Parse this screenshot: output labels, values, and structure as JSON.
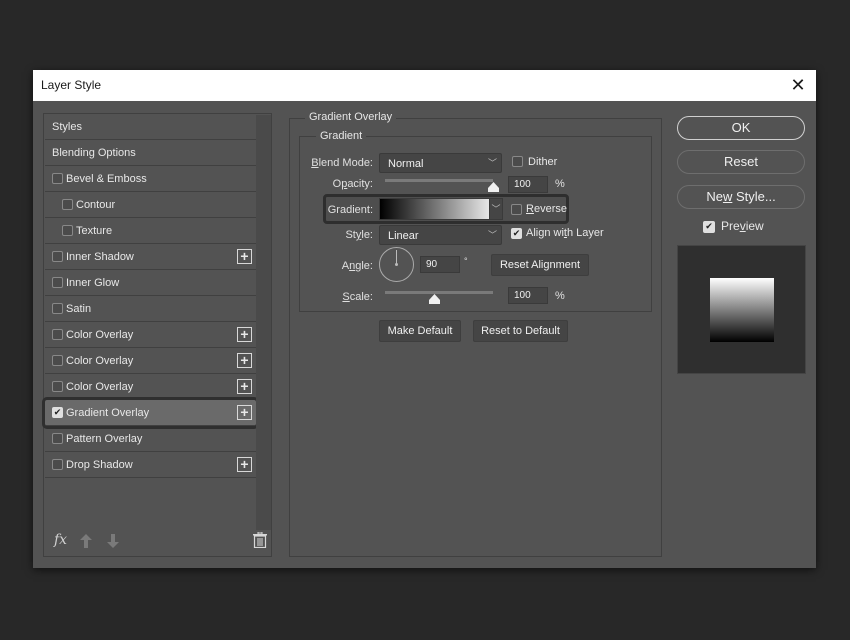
{
  "dialog": {
    "title": "Layer Style",
    "close_icon": "close-icon"
  },
  "stylelist": {
    "items": [
      {
        "label": "Styles",
        "has_checkbox": false,
        "checked": false,
        "has_plus": false,
        "indent": false
      },
      {
        "label": "Blending Options",
        "has_checkbox": false,
        "checked": false,
        "has_plus": false,
        "indent": false
      },
      {
        "label": "Bevel & Emboss",
        "has_checkbox": true,
        "checked": false,
        "has_plus": false,
        "indent": false
      },
      {
        "label": "Contour",
        "has_checkbox": true,
        "checked": false,
        "has_plus": false,
        "indent": true
      },
      {
        "label": "Texture",
        "has_checkbox": true,
        "checked": false,
        "has_plus": false,
        "indent": true
      },
      {
        "label": "Inner Shadow",
        "has_checkbox": true,
        "checked": false,
        "has_plus": true,
        "indent": false
      },
      {
        "label": "Inner Glow",
        "has_checkbox": true,
        "checked": false,
        "has_plus": false,
        "indent": false
      },
      {
        "label": "Satin",
        "has_checkbox": true,
        "checked": false,
        "has_plus": false,
        "indent": false
      },
      {
        "label": "Color Overlay",
        "has_checkbox": true,
        "checked": false,
        "has_plus": true,
        "indent": false
      },
      {
        "label": "Color Overlay",
        "has_checkbox": true,
        "checked": false,
        "has_plus": true,
        "indent": false
      },
      {
        "label": "Color Overlay",
        "has_checkbox": true,
        "checked": false,
        "has_plus": true,
        "indent": false
      },
      {
        "label": "Gradient Overlay",
        "has_checkbox": true,
        "checked": true,
        "has_plus": true,
        "indent": false,
        "selected": true
      },
      {
        "label": "Pattern Overlay",
        "has_checkbox": true,
        "checked": false,
        "has_plus": false,
        "indent": false
      },
      {
        "label": "Drop Shadow",
        "has_checkbox": true,
        "checked": false,
        "has_plus": true,
        "indent": false
      }
    ],
    "footer": {
      "fx_label": "fx",
      "icons": [
        "fx-menu-icon",
        "move-up-icon",
        "move-down-icon",
        "trash-icon"
      ]
    }
  },
  "panel": {
    "section_title": "Gradient Overlay",
    "group_title": "Gradient",
    "blend_mode": {
      "label_prefix": "",
      "label_u": "B",
      "label_rest": "lend Mode:",
      "value": "Normal"
    },
    "dither": {
      "label": "Dither",
      "checked": false
    },
    "opacity": {
      "label_pre": "O",
      "label_u": "p",
      "label_rest": "acity:",
      "value": "100",
      "unit": "%",
      "fraction": 1.0
    },
    "gradient": {
      "label": "Gradient:",
      "from_color": "#000000",
      "to_color": "#ffffff"
    },
    "reverse": {
      "label_u": "R",
      "label_rest": "everse",
      "checked": false
    },
    "style": {
      "label_pre": "St",
      "label_u": "y",
      "label_rest": "le:",
      "value": "Linear"
    },
    "align_with_layer": {
      "label_pre": "Align wi",
      "label_u": "t",
      "label_rest": "h Layer",
      "checked": true
    },
    "angle": {
      "label_pre": "A",
      "label_u": "n",
      "label_rest": "gle:",
      "value": "90",
      "unit": "°"
    },
    "reset_alignment": "Reset Alignment",
    "scale": {
      "label_u": "S",
      "label_rest": "cale:",
      "value": "100",
      "unit": "%",
      "fraction": 0.45
    },
    "make_default": "Make Default",
    "reset_to_default": "Reset to Default"
  },
  "actions": {
    "ok": "OK",
    "reset": "Reset",
    "new_style_pre": "Ne",
    "new_style_u": "w",
    "new_style_rest": " Style...",
    "preview": {
      "label_pre": "Pre",
      "label_u": "v",
      "label_rest": "iew",
      "checked": true
    },
    "preview_swatch": {
      "top_color": "#ffffff",
      "bottom_color": "#000000"
    }
  }
}
